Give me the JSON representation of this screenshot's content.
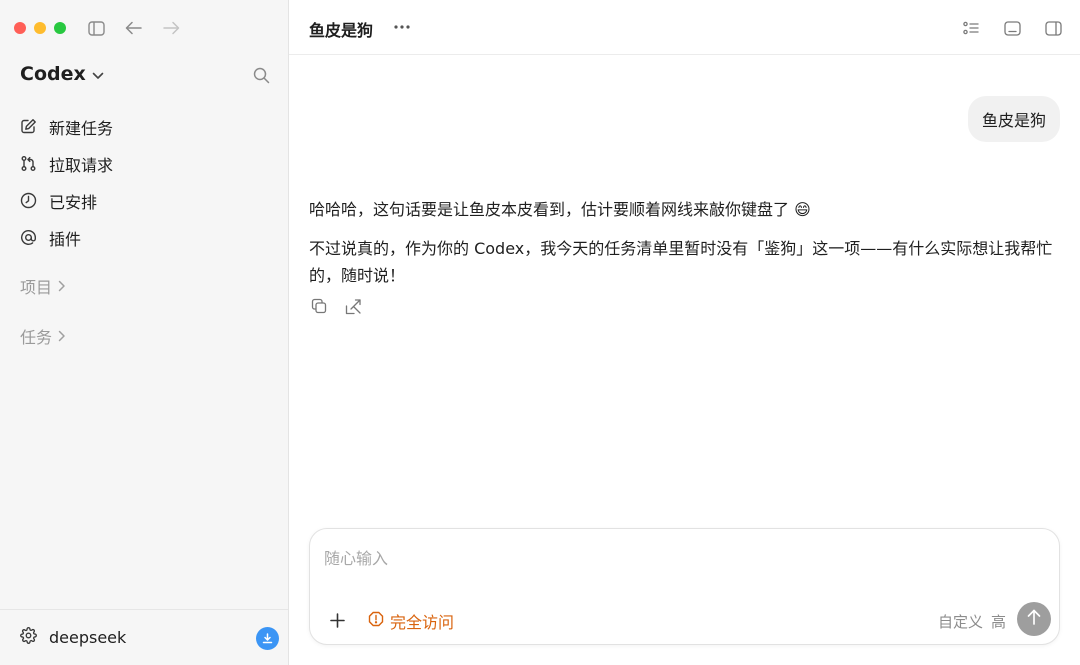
{
  "window": {
    "traffic_lights": {
      "close": "#ff5f57",
      "minimize": "#febc2e",
      "zoom": "#28c840"
    }
  },
  "sidebar": {
    "workspace_title": "Codex",
    "nav_items": [
      {
        "icon": "edit-icon",
        "label": "新建任务"
      },
      {
        "icon": "pull-request-icon",
        "label": "拉取请求"
      },
      {
        "icon": "clock-icon",
        "label": "已安排"
      },
      {
        "icon": "at-icon",
        "label": "插件"
      }
    ],
    "sections": {
      "projects": "项目",
      "tasks": "任务"
    },
    "footer": {
      "user": "deepseek",
      "badge_color": "#3b95f5"
    }
  },
  "conversation": {
    "title": "鱼皮是狗",
    "user_message": "鱼皮是狗",
    "assistant_paragraphs": [
      "哈哈哈，这句话要是让鱼皮本皮看到，估计要顺着网线来敲你键盘了 😄",
      "不过说真的，作为你的 Codex，我今天的任务清单里暂时没有「鉴狗」这一项——有什么实际想让我帮忙的，随时说！"
    ]
  },
  "composer": {
    "placeholder": "随心输入",
    "value": "",
    "access_label": "完全访问",
    "access_color": "#d9630d",
    "custom_label": "自定义",
    "level_label": "高"
  }
}
